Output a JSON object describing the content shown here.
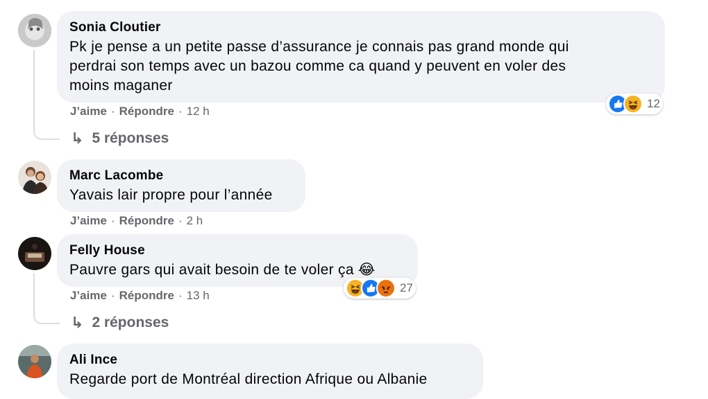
{
  "comments": [
    {
      "author": "Sonia Cloutier",
      "text_line1": "Pk je pense a un petite passe d’assurance je connais pas grand monde qui",
      "text_line2": "perdrai son temps avec un bazou comme ca quand y peuvent en voler des",
      "text_line3": "moins maganer",
      "like_label": "J’aime",
      "reply_label": "Répondre",
      "time": "12 h",
      "reaction_count": "12",
      "reaction_icons": [
        "like-icon",
        "haha-icon"
      ],
      "replies_label": "5 réponses"
    },
    {
      "author": "Marc Lacombe",
      "text_line1": "Yavais lair propre pour l’année",
      "like_label": "J’aime",
      "reply_label": "Répondre",
      "time": "2 h"
    },
    {
      "author": "Felly House",
      "text_line1": "Pauvre gars qui avait besoin de te voler ça 😂",
      "like_label": "J’aime",
      "reply_label": "Répondre",
      "time": "13 h",
      "reaction_count": "27",
      "reaction_icons": [
        "haha-icon",
        "like-icon",
        "angry-icon"
      ],
      "replies_label": "2 réponses"
    },
    {
      "author": "Ali Ince",
      "text_line1": "Regarde port de Montréal direction Afrique ou Albanie"
    }
  ],
  "separator": "·",
  "colors": {
    "bubble": "#f0f2f5",
    "meta": "#65676b",
    "like": "#1877f2",
    "haha": "#f7b125",
    "angry": "#e9710f"
  }
}
